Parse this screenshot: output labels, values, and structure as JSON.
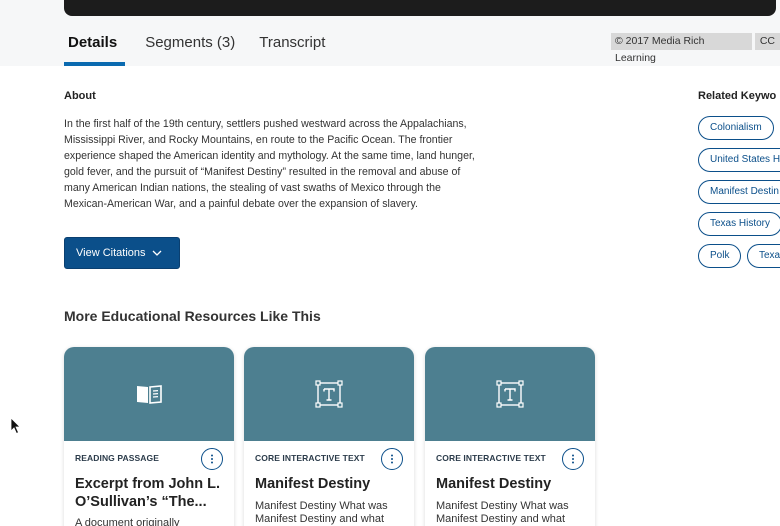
{
  "tabs": [
    {
      "label": "Details"
    },
    {
      "label": "Segments (3)"
    },
    {
      "label": "Transcript"
    }
  ],
  "copyright": {
    "text": "© 2017 Media Rich Learning",
    "cc": "CC"
  },
  "about": {
    "heading": "About",
    "lines": [
      "In the first half of the 19th century, settlers pushed westward across the Appalachians,",
      "Mississippi River, and Rocky Mountains, en route to the Pacific Ocean. The frontier",
      "experience shaped the American identity and mythology. At the same time, land hunger,",
      "gold fever, and the pursuit of “Manifest Destiny” resulted in the removal and abuse of",
      "many American Indian nations, the stealing of vast swaths of Mexico through the",
      "Mexican-American War, and a painful debate over the expansion of slavery."
    ]
  },
  "citations": {
    "label": "View Citations"
  },
  "related": {
    "heading": "Related Keywo",
    "keywords": [
      "Colonialism",
      "United States H",
      "Manifest Destin",
      "Texas History",
      "Polk",
      "Texa"
    ]
  },
  "more": {
    "heading": "More Educational Resources Like This"
  },
  "cards": [
    {
      "type": "READING PASSAGE",
      "title_lines": [
        "Excerpt from John L.",
        "O’Sullivan’s “The..."
      ],
      "desc_lines": [
        "A document originally"
      ],
      "icon": "book-icon"
    },
    {
      "type": "CORE INTERACTIVE TEXT",
      "title_lines": [
        "Manifest Destiny"
      ],
      "desc_lines": [
        "Manifest Destiny What was",
        "Manifest Destiny and what"
      ],
      "icon": "text-frame-icon"
    },
    {
      "type": "CORE INTERACTIVE TEXT",
      "title_lines": [
        "Manifest Destiny"
      ],
      "desc_lines": [
        "Manifest Destiny What was",
        "Manifest Destiny and what"
      ],
      "icon": "text-frame-icon"
    }
  ],
  "colors": {
    "accent": "#0b4f8a",
    "tab_underline": "#0a6ab0",
    "card_thumb": "#4d7f90"
  }
}
